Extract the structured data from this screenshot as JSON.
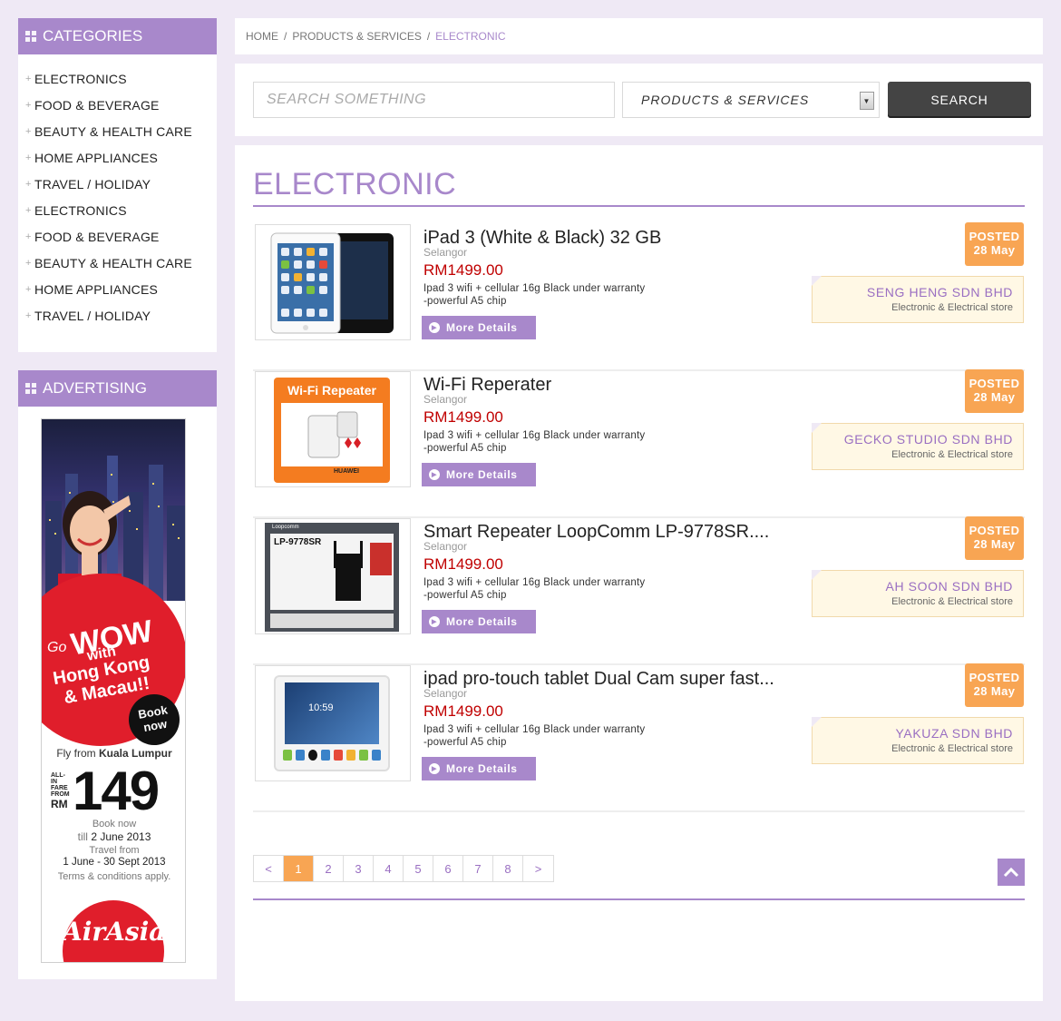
{
  "sidebar": {
    "categories_title": "CATEGORIES",
    "categories": [
      "ELECTRONICS",
      "FOOD & BEVERAGE",
      "BEAUTY & HEALTH CARE",
      "HOME APPLIANCES",
      "TRAVEL / HOLIDAY",
      "ELECTRONICS",
      "FOOD & BEVERAGE",
      "BEAUTY & HEALTH CARE",
      "HOME APPLIANCES",
      "TRAVEL / HOLIDAY"
    ],
    "advertising_title": "ADVERTISING",
    "ad": {
      "go": "Go",
      "wow": "WOW",
      "with": "with",
      "line1": "Hong Kong",
      "line2": "& Macau!!",
      "book": "Book",
      "now": "now",
      "fly_from": "Fly from",
      "city": "Kuala Lumpur",
      "fare_label": "ALL-IN FARE FROM",
      "currency": "RM",
      "price": "149",
      "book_now": "Book now",
      "till": "till",
      "till_date": "2 June 2013",
      "travel_from": "Travel from",
      "travel_dates": "1 June - 30 Sept 2013",
      "terms": "Terms & conditions apply.",
      "brand": "AirAsia"
    }
  },
  "breadcrumb": {
    "home": "HOME",
    "sep": "/",
    "section": "PRODUCTS & SERVICES",
    "current": "ELECTRONIC"
  },
  "search": {
    "placeholder": "SEARCH SOMETHING",
    "select_value": "PRODUCTS & SERVICES",
    "button": "SEARCH"
  },
  "page_title": "ELECTRONIC",
  "products": [
    {
      "name": "iPad 3 (White & Black) 32 GB",
      "location": "Selangor",
      "price": "RM1499.00",
      "desc1": "Ipad 3 wifi + cellular 16g Black under warranty",
      "desc2": "-powerful A5 chip",
      "more": "More Details",
      "posted": "POSTED",
      "date": "28 May",
      "seller": "SENG HENG SDN BHD",
      "seller_type": "Electronic & Electrical store"
    },
    {
      "name": "Wi-Fi Reperater",
      "location": "Selangor",
      "price": "RM1499.00",
      "desc1": "Ipad 3 wifi + cellular 16g Black under warranty",
      "desc2": "-powerful A5 chip",
      "more": "More Details",
      "posted": "POSTED",
      "date": "28 May",
      "seller": "GECKO STUDIO SDN BHD",
      "seller_type": "Electronic & Electrical store",
      "thumb_title": "Wi-Fi Repeater",
      "thumb_brand": "HUAWEI"
    },
    {
      "name": "Smart Repeater LoopComm LP-9778SR....",
      "location": "Selangor",
      "price": "RM1499.00",
      "desc1": "Ipad 3 wifi + cellular 16g Black under warranty",
      "desc2": "-powerful A5 chip",
      "more": "More Details",
      "posted": "POSTED",
      "date": "28 May",
      "seller": "AH SOON SDN BHD",
      "seller_type": "Electronic & Electrical store",
      "thumb_brand": "Loopcomm",
      "thumb_model": "LP-9778SR"
    },
    {
      "name": "ipad pro-touch tablet Dual Cam super fast...",
      "location": "Selangor",
      "price": "RM1499.00",
      "desc1": "Ipad 3 wifi + cellular 16g Black under warranty",
      "desc2": "-powerful A5 chip",
      "more": "More Details",
      "posted": "POSTED",
      "date": "28 May",
      "seller": "YAKUZA SDN BHD",
      "seller_type": "Electronic & Electrical store",
      "thumb_clock": "10:59"
    }
  ],
  "pagination": {
    "prev": "<",
    "pages": [
      "1",
      "2",
      "3",
      "4",
      "5",
      "6",
      "7",
      "8"
    ],
    "next": ">",
    "active": "1"
  },
  "colors": {
    "accent": "#a888cb",
    "orange": "#f8a553",
    "price_red": "#c00000",
    "background": "#efe9f5"
  }
}
